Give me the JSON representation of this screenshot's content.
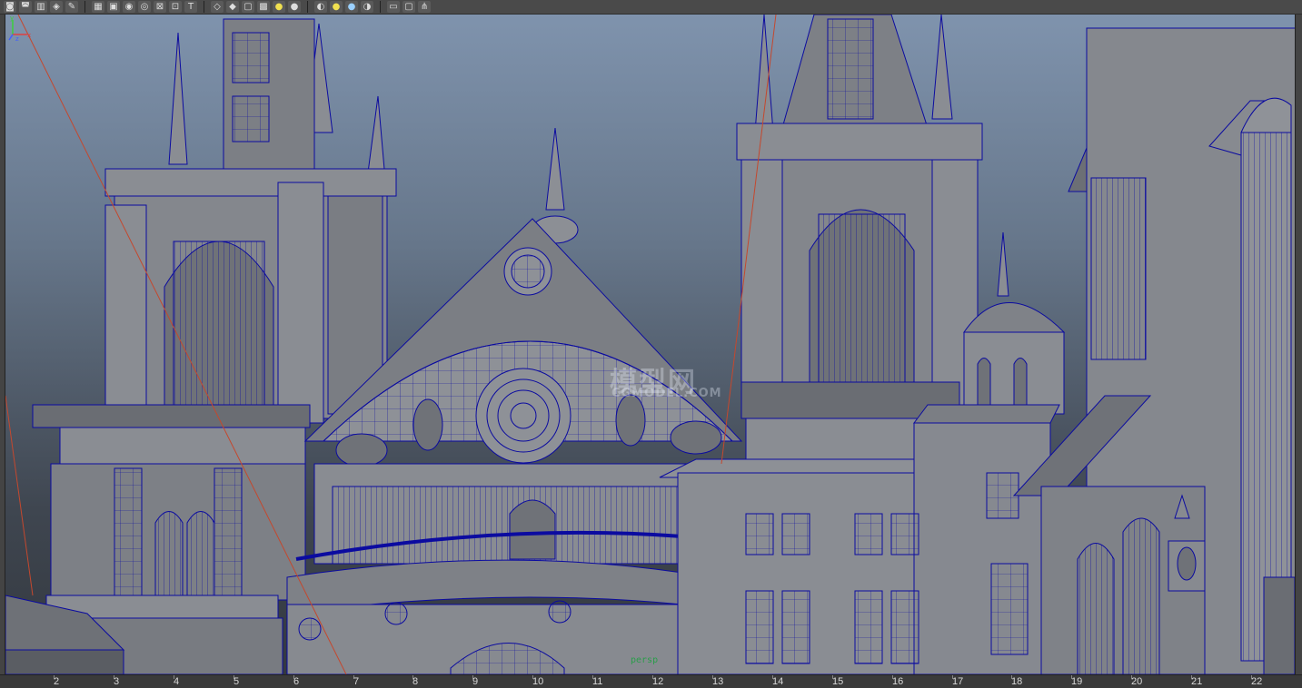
{
  "toolbar": {
    "icons": [
      "camera-attributes-icon",
      "camera-tools-icon",
      "image-plane-icon",
      "bookmark-icon",
      "grease-pencil-icon",
      "grid-icon",
      "film-gate-icon",
      "resolution-gate-icon",
      "gate-mask-icon",
      "field-chart-icon",
      "safe-action-icon",
      "safe-title-icon",
      "wireframe-shading-icon",
      "smooth-shading-icon",
      "default-material-icon",
      "shadows-icon",
      "xray-icon",
      "textured-icon",
      "isolate-select-icon",
      "use-default-lights-icon",
      "all-lights-icon",
      "ambient-occlusion-icon",
      "select-camera-icon",
      "viewport-layout-icon",
      "share-icon"
    ]
  },
  "viewport": {
    "camera_label": "persp",
    "watermark_text": "模型网",
    "watermark_sub": "CGMODEL.COM",
    "axis": {
      "x_label": "x",
      "y_label": "y",
      "z_label": "z"
    }
  },
  "timeline": {
    "ticks": [
      "2",
      "3",
      "4",
      "5",
      "6",
      "7",
      "8",
      "9",
      "10",
      "11",
      "12",
      "13",
      "14",
      "15",
      "16",
      "17",
      "18",
      "19",
      "20",
      "21",
      "22"
    ]
  },
  "colors": {
    "wireframe": "#0b0ba0",
    "geometry": "#8a8d93",
    "background_top": "#7f93ad",
    "background_bottom": "#33383f",
    "camera_label": "#2a9d4a",
    "camera_line": "#c4482e"
  }
}
